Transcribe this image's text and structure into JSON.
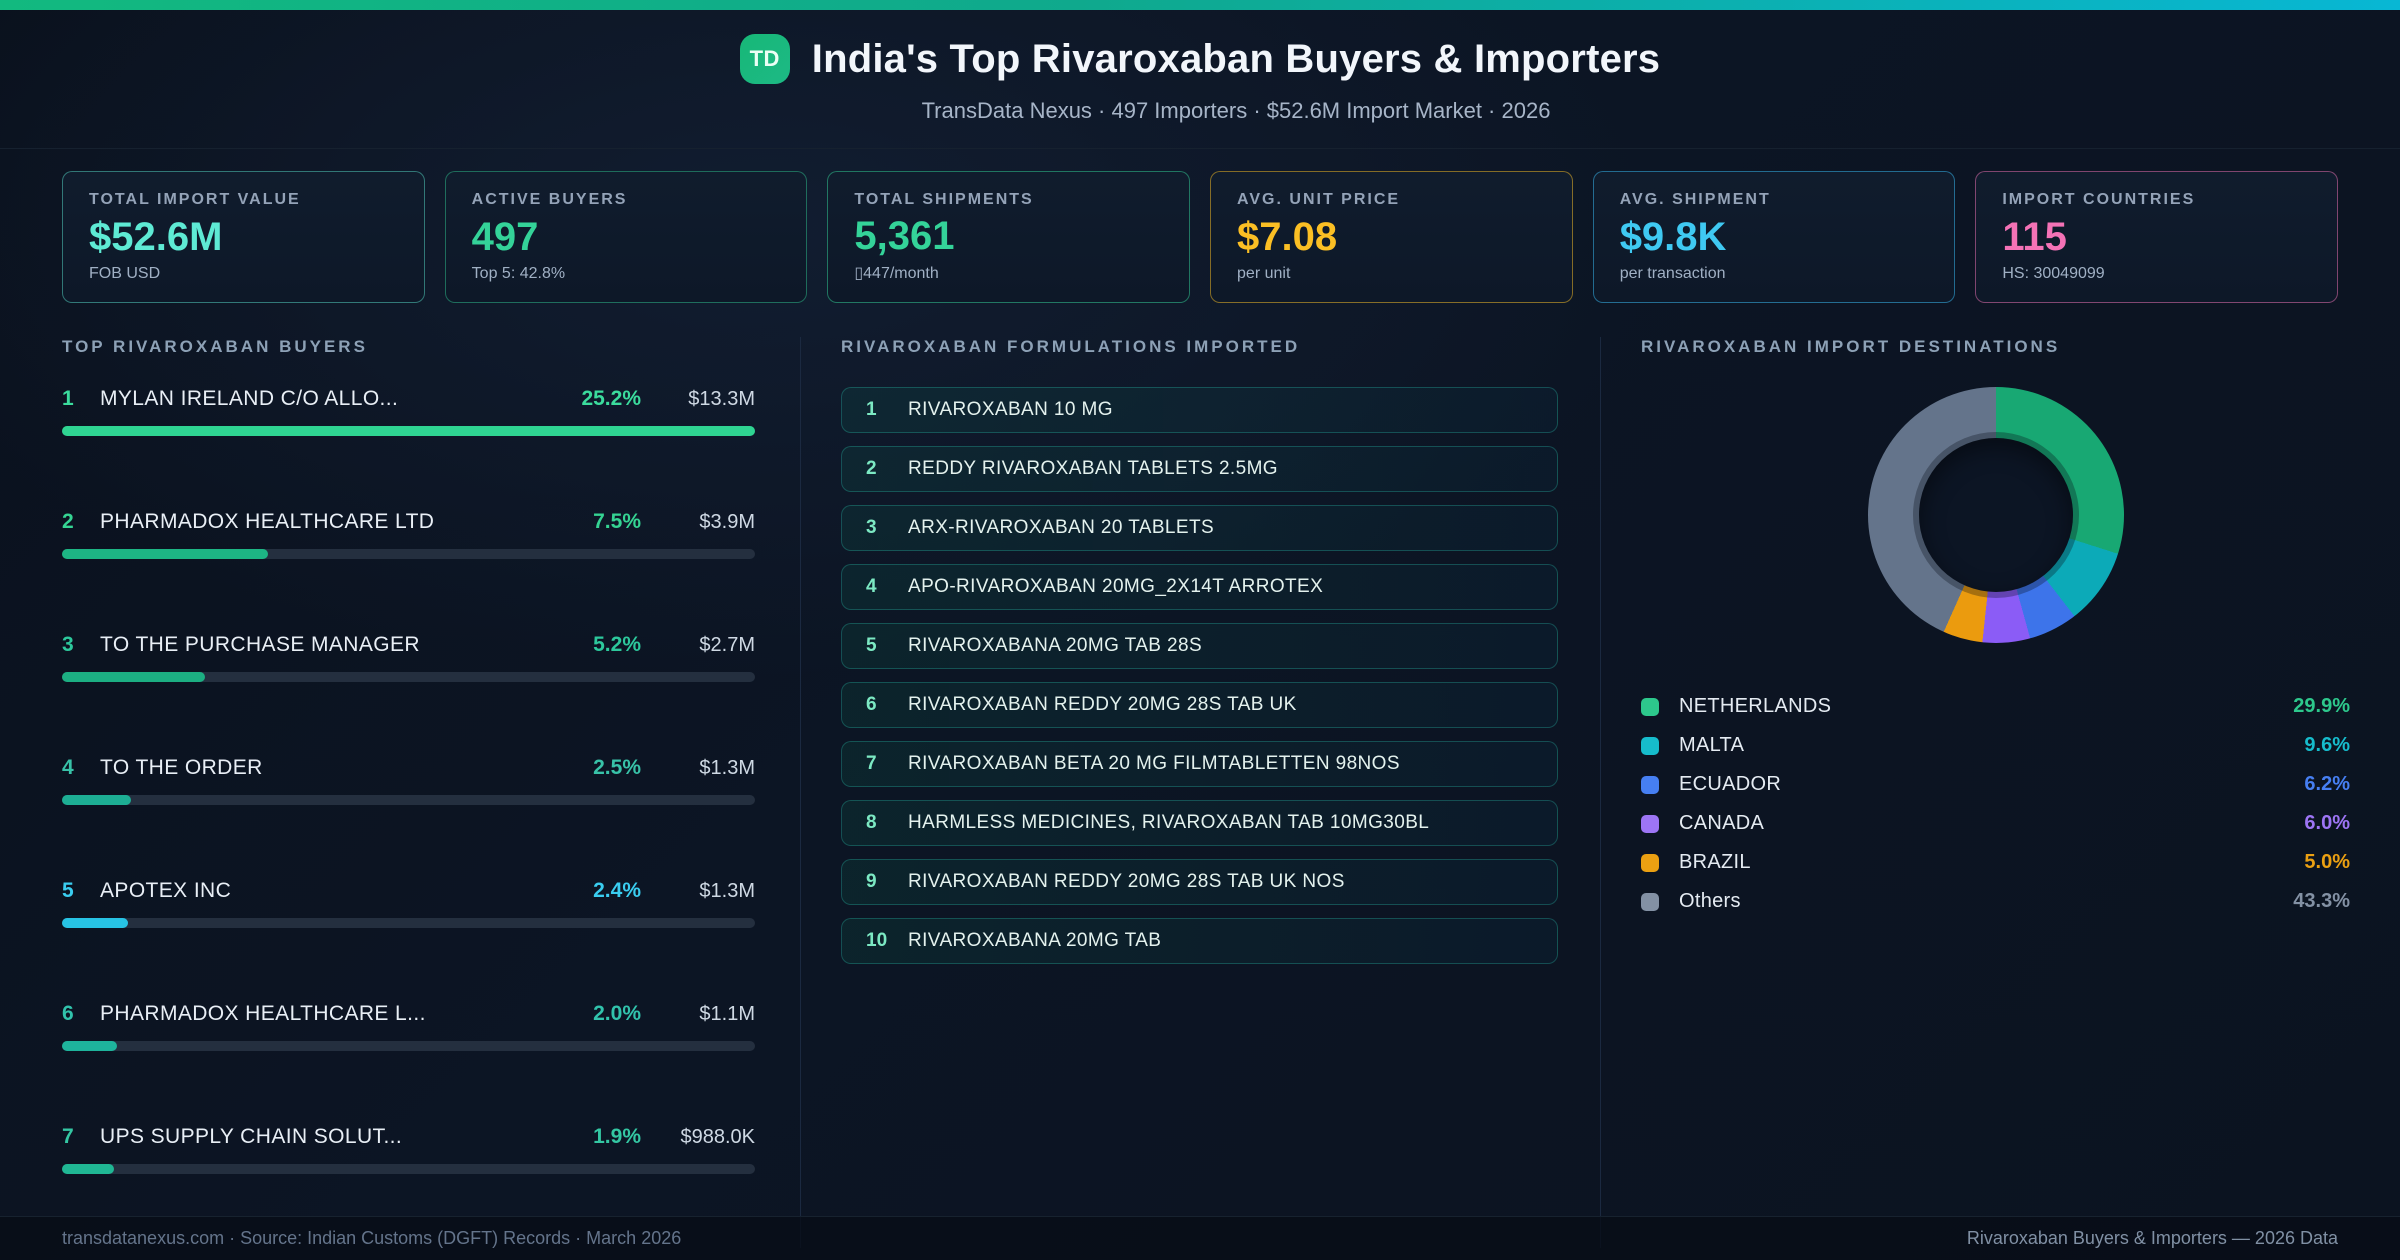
{
  "header": {
    "logo": "TD",
    "title": "India's Top Rivaroxaban Buyers & Importers",
    "subtitle": "TransData Nexus · 497 Importers · $52.6M Import Market · 2026"
  },
  "stats": [
    {
      "label": "TOTAL IMPORT VALUE",
      "value": "$52.6M",
      "sub": "FOB USD",
      "value_color": "#5eead4",
      "border_color": "rgba(94,234,212,0.45)"
    },
    {
      "label": "ACTIVE BUYERS",
      "value": "497",
      "sub": "Top 5: 42.8%",
      "value_color": "#34d399",
      "border_color": "rgba(52,211,153,0.45)"
    },
    {
      "label": "TOTAL SHIPMENTS",
      "value": "5,361",
      "sub": "▯447/month",
      "value_color": "#34d399",
      "border_color": "rgba(52,211,153,0.50)"
    },
    {
      "label": "AVG. UNIT PRICE",
      "value": "$7.08",
      "sub": "per unit",
      "value_color": "#fbbf24",
      "border_color": "rgba(251,191,36,0.50)"
    },
    {
      "label": "AVG. SHIPMENT",
      "value": "$9.8K",
      "sub": "per transaction",
      "value_color": "#3fc9f2",
      "border_color": "rgba(56,189,248,0.50)"
    },
    {
      "label": "IMPORT COUNTRIES",
      "value": "115",
      "sub": "HS: 30049099",
      "value_color": "#f472b6",
      "border_color": "rgba(244,114,182,0.50)"
    }
  ],
  "panels": {
    "formulations": {
      "title": "RIVAROXABAN FORMULATIONS IMPORTED",
      "items": [
        "RIVAROXABAN 10 MG",
        "REDDY RIVAROXABAN TABLETS 2.5MG",
        "ARX-RIVAROXABAN 20 TABLETS",
        "APO-RIVAROXABAN 20MG_2X14T ARROTEX",
        "RIVAROXABANA 20MG TAB 28S",
        "RIVAROXABAN REDDY 20MG 28S TAB UK",
        "RIVAROXABAN BETA 20 MG FILMTABLETTEN 98NOS",
        "HARMLESS MEDICINES, RIVAROXABAN TAB 10MG30BL",
        "RIVAROXABAN REDDY 20MG 28S TAB UK NOS",
        "RIVAROXABANA 20MG TAB"
      ]
    }
  },
  "chart_data": [
    {
      "type": "bar",
      "orientation": "horizontal",
      "title": "TOP RIVAROXABAN BUYERS",
      "categories": [
        "MYLAN IRELAND C/O ALLO...",
        "PHARMADOX HEALTHCARE LTD",
        "TO THE PURCHASE MANAGER",
        "TO THE ORDER",
        "APOTEX INC",
        "PHARMADOX HEALTHCARE L...",
        "UPS SUPPLY CHAIN SOLUT..."
      ],
      "share_pct": [
        25.2,
        7.5,
        5.2,
        2.5,
        2.4,
        2.0,
        1.9
      ],
      "value_labels": [
        "$13.3M",
        "$3.9M",
        "$2.7M",
        "$1.3M",
        "$1.3M",
        "$1.1M",
        "$988.0K"
      ],
      "text_colors": [
        "#3bdc9d",
        "#35d493",
        "#2dc89c",
        "#38c2a8",
        "#3acdf0",
        "#31c3ac",
        "#34c7a3"
      ],
      "bar_colors": [
        "#2fd492",
        "#1db584",
        "#1caf82",
        "#1dae94",
        "#27c3e4",
        "#1eb49c",
        "#20b794"
      ],
      "xlim": [
        0,
        25.2
      ]
    },
    {
      "type": "pie",
      "donut": true,
      "title": "RIVAROXABAN IMPORT DESTINATIONS",
      "categories": [
        "NETHERLANDS",
        "MALTA",
        "ECUADOR",
        "CANADA",
        "BRAZIL",
        "Others"
      ],
      "values": [
        29.9,
        9.6,
        6.2,
        6.0,
        5.0,
        43.3
      ],
      "value_labels": [
        "29.9%",
        "9.6%",
        "6.2%",
        "6.0%",
        "5.0%",
        "43.3%"
      ],
      "colors": [
        "#18a873",
        "#0caab8",
        "#3d74ea",
        "#8b5cf6",
        "#eb9b0e",
        "#64748b"
      ],
      "legend_colors": [
        "#2dc88c",
        "#16bccc",
        "#467ff2",
        "#9d75f5",
        "#eba012",
        "#8391a4"
      ],
      "start_angle_deg": 0,
      "direction": "clockwise",
      "legend_position": "bottom"
    }
  ],
  "footer": {
    "left": "transdatanexus.com · Source: Indian Customs (DGFT) Records · March 2026",
    "right": "Rivaroxaban Buyers & Importers — 2026 Data"
  }
}
